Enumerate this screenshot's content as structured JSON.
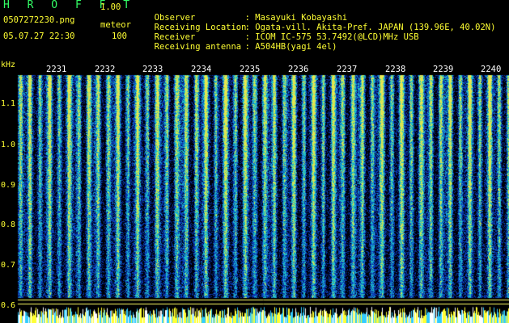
{
  "header": {
    "title": "H R O F F T",
    "version": "1.00",
    "filename": "0507272230.png",
    "mode": "meteor",
    "datetime": "05.07.27 22:30",
    "count": "100"
  },
  "info": [
    {
      "key": "Observer",
      "value": ": Masayuki Kobayashi"
    },
    {
      "key": "Receiving Location",
      "value": ": Ogata-vill. Akita-Pref. JAPAN (139.96E, 40.02N)"
    },
    {
      "key": "Receiver",
      "value": ": ICOM IC-575 53.7492(@LCD)MHz USB"
    },
    {
      "key": "Receiving antenna",
      "value": ": A504HB(yagi 4el)"
    }
  ],
  "axis": {
    "unit": "kHz",
    "y_ticks": [
      "1.1",
      "1.0",
      "0.9",
      "0.8",
      "0.7",
      "0.6"
    ],
    "x_ticks": [
      "2231",
      "2232",
      "2233",
      "2234",
      "2235",
      "2236",
      "2237",
      "2238",
      "2239",
      "2240"
    ]
  },
  "colors": {
    "background": "#000000",
    "header_text": "#ffff33",
    "title_text": "#33ff66",
    "spectrum_low": "#0a1a6e",
    "spectrum_mid": "#1fa0d8",
    "spectrum_high": "#c8ff40"
  }
}
